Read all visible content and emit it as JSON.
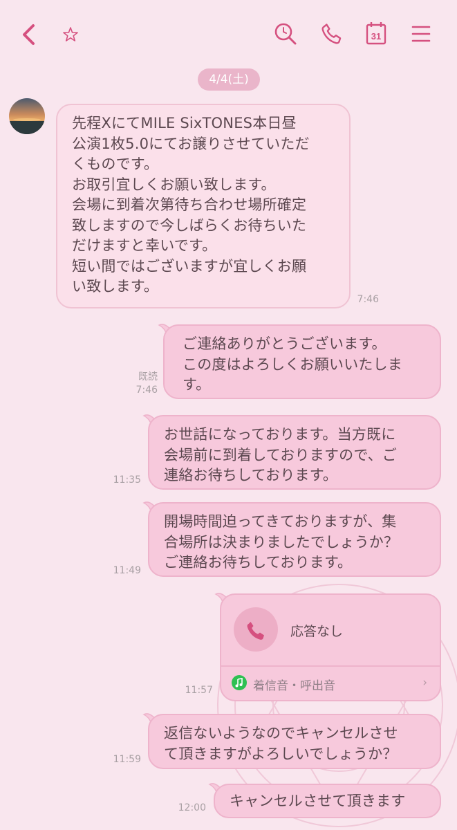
{
  "header": {
    "back_icon": "chevron-left-icon",
    "favorite_icon": "star-icon",
    "action_icons": [
      "search-icon",
      "phone-icon",
      "calendar-icon",
      "menu-icon"
    ],
    "calendar_day": "31"
  },
  "colors": {
    "accent": "#d5507f",
    "background": "#f9e6ee",
    "bubble_outgoing": "#f7c9dc",
    "bubble_incoming": "#fbe0ea",
    "bubble_border": "#eeb3cb",
    "text": "#5c4850",
    "time_text": "#a9a0a4",
    "ringtone_green": "#2fc052"
  },
  "date_label": "4/4(土)",
  "messages": [
    {
      "side": "incoming",
      "text": "先程XにてMILE SixTONES本日昼\n公演1枚5.0にてお譲りさせていただ\nくものです。\nお取引宜しくお願い致します。\n会場に到着次第待ち合わせ場所確定\n致しますので今しばらくお待ちいた\nだけますと幸いです。\n短い間ではございますが宜しくお願\nい致します。",
      "time": "7:46"
    },
    {
      "side": "outgoing",
      "text": "ご連絡ありがとうございます。\nこの度はよろしくお願いいたしま\nす。",
      "read": "既読",
      "time": "7:46"
    },
    {
      "side": "outgoing",
      "text": "お世話になっております。当方既に\n会場前に到着しておりますので、ご\n連絡お待ちしております。",
      "time": "11:35"
    },
    {
      "side": "outgoing",
      "text": "開場時間迫ってきておりますが、集\n合場所は決まりましたでしょうか？\nご連絡お待ちしております。",
      "time": "11:49"
    },
    {
      "side": "outgoing",
      "type": "call",
      "call_status": "応答なし",
      "ringtone_label": "着信音・呼出音",
      "time": "11:57"
    },
    {
      "side": "outgoing",
      "text": "返信ないようなのでキャンセルさせ\nて頂きますがよろしいでしょうか？",
      "time": "11:59"
    },
    {
      "side": "outgoing",
      "text": "キャンセルさせて頂きます",
      "time": "12:00"
    }
  ]
}
